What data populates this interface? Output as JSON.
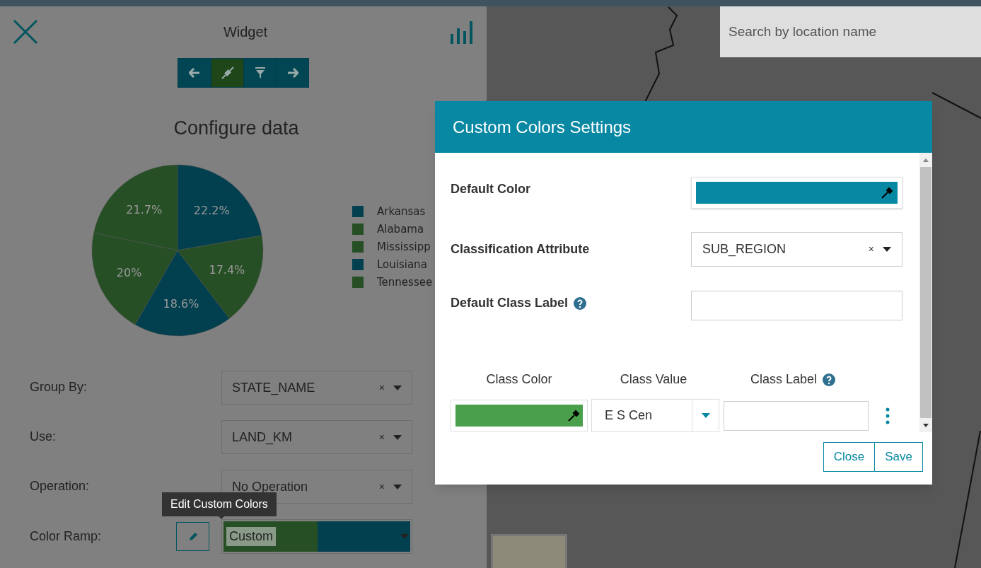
{
  "widget": {
    "title": "Widget",
    "toolbar": [
      {
        "kind": "back",
        "selected": false
      },
      {
        "kind": "connect",
        "selected": true
      },
      {
        "kind": "filter",
        "selected": false
      },
      {
        "kind": "forward",
        "selected": false
      }
    ],
    "heading": "Configure data",
    "chart_data": {
      "type": "pie",
      "categories": [
        "Arkansas",
        "Alabama",
        "Mississipp",
        "Louisiana",
        "Tennessee"
      ],
      "values": [
        22.2,
        21.7,
        20,
        18.6,
        17.4
      ],
      "legend": "right",
      "colors": [
        "#023f4f",
        "#264f25",
        "#264f25",
        "#023f4f",
        "#264f25"
      ],
      "value_labels": [
        "22.2%",
        "21.7%",
        "20%",
        "18.6%",
        "17.4%"
      ]
    },
    "fields": [
      {
        "label": "Group By:",
        "value": "STATE_NAME",
        "clear": "×"
      },
      {
        "label": "Use:",
        "value": "LAND_KM",
        "clear": "×"
      },
      {
        "label": "Operation:",
        "value": "No Operation",
        "clear": "×"
      }
    ],
    "color_ramp": {
      "label": "Color Ramp:",
      "value": "Custom",
      "tooltip": "Edit Custom Colors"
    }
  },
  "map": {
    "search": {
      "placeholder": "Search by location name"
    }
  },
  "dialog": {
    "title": "Custom Colors Settings",
    "default_color": {
      "label": "Default Color",
      "color": "#0888a3"
    },
    "classification": {
      "label": "Classification Attribute",
      "value": "SUB_REGION",
      "clear": "×"
    },
    "default_class_label": {
      "label": "Default Class Label"
    },
    "columns": [
      "Class Color",
      "Class Value",
      "Class Label"
    ],
    "rows": [
      {
        "color": "#4aa04a",
        "value": "E S Cen"
      }
    ],
    "buttons": [
      "Close",
      "Save"
    ]
  }
}
